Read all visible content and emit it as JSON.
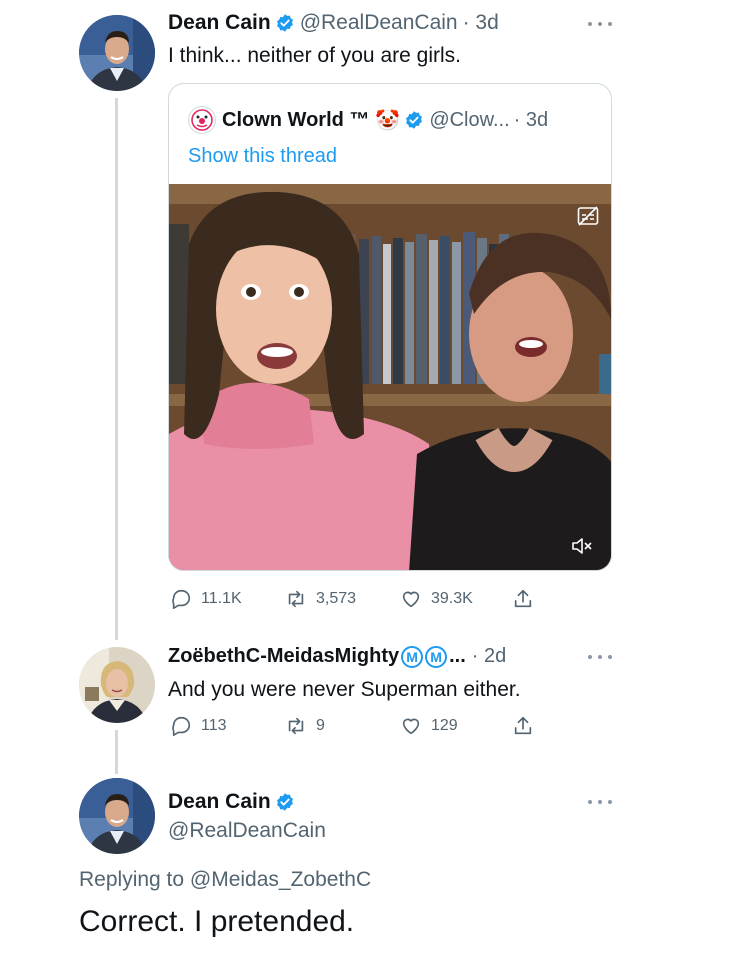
{
  "tweet1": {
    "name": "Dean Cain",
    "handle": "@RealDeanCain",
    "time": "· 3d",
    "text": "I think... neither of you are girls."
  },
  "quote": {
    "name": "Clown World ™",
    "emoji": "🤡",
    "handle": "@Clow...",
    "time": "· 3d",
    "link": "Show this thread"
  },
  "tweet1_stats": {
    "replies": "11.1K",
    "retweets": "3,573",
    "likes": "39.3K"
  },
  "tweet2": {
    "name": "ZoëbethC-MeidasMighty",
    "badges": [
      "M",
      "M"
    ],
    "ellipsis": "...",
    "time": "· 2d",
    "text": "And you were never Superman either."
  },
  "tweet2_stats": {
    "replies": "113",
    "retweets": "9",
    "likes": "129"
  },
  "tweet3": {
    "name": "Dean Cain",
    "handle": "@RealDeanCain",
    "replying_label": "Replying to",
    "replying_handle": "@Meidas_ZobethC",
    "text": "Correct. I pretended."
  },
  "colors": {
    "accent": "#1d9bf0",
    "secondary_text": "#536471",
    "border": "#cfd9de"
  },
  "icons": [
    "verified-badge-icon",
    "more-icon",
    "reply-icon",
    "retweet-icon",
    "like-icon",
    "share-icon",
    "mute-icon",
    "captions-off-icon"
  ]
}
